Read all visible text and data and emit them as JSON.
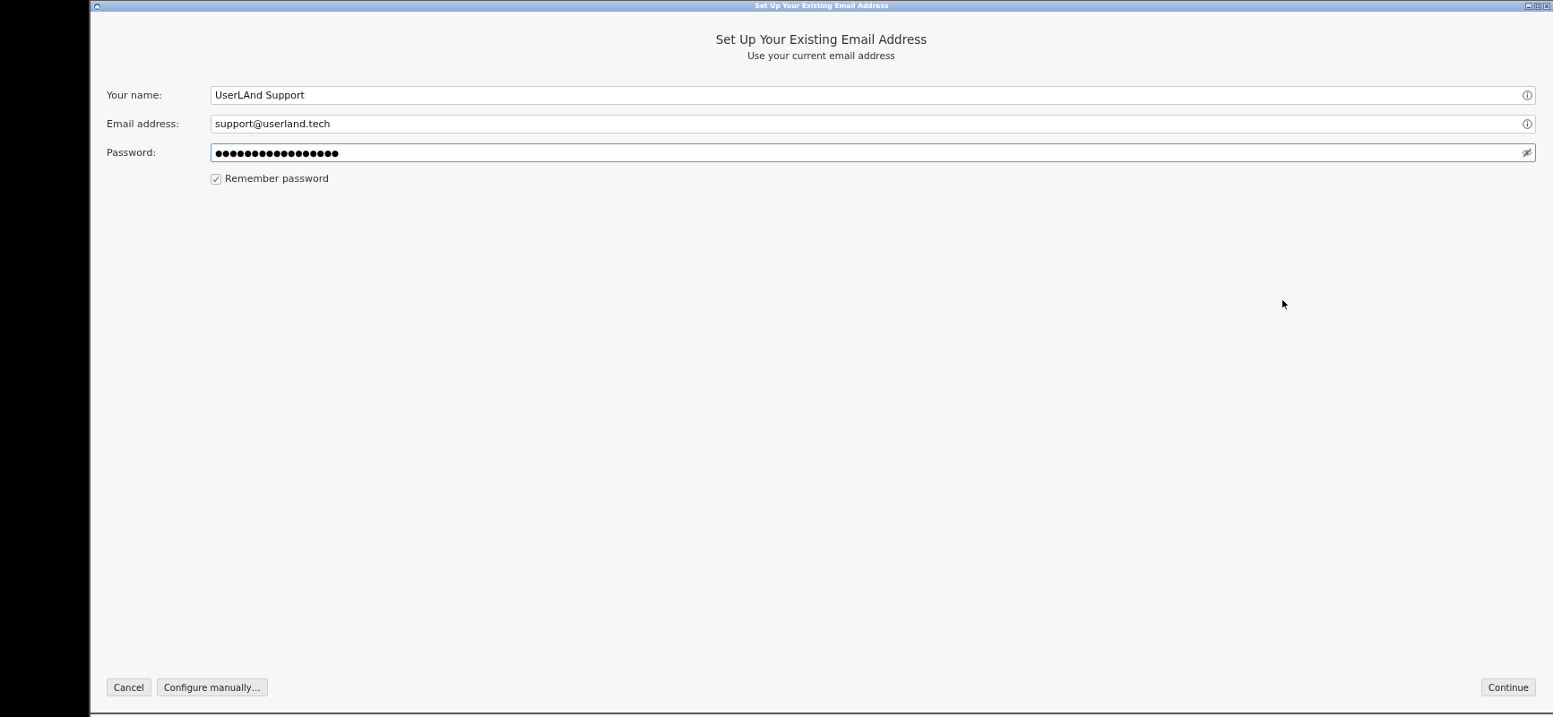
{
  "window": {
    "title": "Set Up Your Existing Email Address"
  },
  "header": {
    "heading": "Set Up Your Existing Email Address",
    "subheading": "Use your current email address"
  },
  "fields": [
    {
      "kind": "text",
      "label": "Your name:",
      "value": "UserLAnd Support",
      "focused": false
    },
    {
      "kind": "text",
      "label": "Email address:",
      "value": "support@userland.tech",
      "focused": false
    },
    {
      "kind": "password",
      "label": "Password:",
      "value": "●●●●●●●●●●●●●●●●●",
      "focused": true
    }
  ],
  "remember_password": {
    "label": "Remember password",
    "checked": true
  },
  "footer": {
    "left_buttons": [
      {
        "label": "Cancel"
      },
      {
        "label": "Configure manually…"
      }
    ],
    "right_buttons": [
      {
        "label": "Continue"
      }
    ]
  }
}
